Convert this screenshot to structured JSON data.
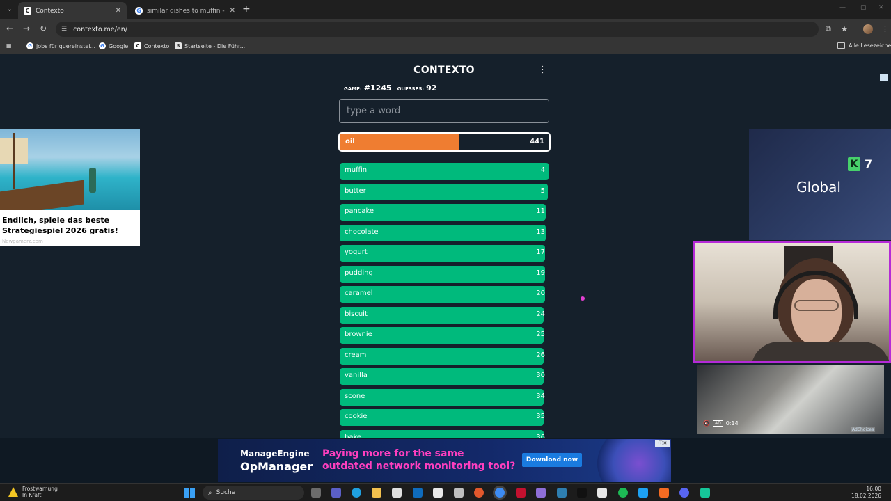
{
  "browser": {
    "tabs": [
      {
        "label": "Contexto",
        "favicon": "C",
        "active": true
      },
      {
        "label": "similar dishes to muffin - Goog",
        "favicon": "G",
        "active": false
      }
    ],
    "new_tab_icon": "+",
    "url": "contexto.me/en/",
    "bookmarks": [
      {
        "label": "jobs für quereinstei...",
        "favicon": "G"
      },
      {
        "label": "Google",
        "favicon": "G"
      },
      {
        "label": "Contexto",
        "favicon": "C"
      },
      {
        "label": "Startseite - Die Führ...",
        "favicon": "S"
      }
    ],
    "all_bookmarks_label": "Alle Lesezeichen"
  },
  "game": {
    "title": "CONTEXTO",
    "game_label": "GAME:",
    "game_number": "#1245",
    "guesses_label": "GUESSES:",
    "guesses_count": "92",
    "input_placeholder": "type a word",
    "current_guess": {
      "word": "oil",
      "rank": "441",
      "fill": 0.57
    },
    "guesses": [
      {
        "word": "muffin",
        "rank": "4",
        "fill": 1.0
      },
      {
        "word": "butter",
        "rank": "5",
        "fill": 0.995
      },
      {
        "word": "pancake",
        "rank": "11",
        "fill": 0.985
      },
      {
        "word": "chocolate",
        "rank": "13",
        "fill": 0.985
      },
      {
        "word": "yogurt",
        "rank": "17",
        "fill": 0.98
      },
      {
        "word": "pudding",
        "rank": "19",
        "fill": 0.98
      },
      {
        "word": "caramel",
        "rank": "20",
        "fill": 0.98
      },
      {
        "word": "biscuit",
        "rank": "24",
        "fill": 0.975
      },
      {
        "word": "brownie",
        "rank": "25",
        "fill": 0.975
      },
      {
        "word": "cream",
        "rank": "26",
        "fill": 0.975
      },
      {
        "word": "vanilla",
        "rank": "30",
        "fill": 0.975
      },
      {
        "word": "scone",
        "rank": "34",
        "fill": 0.975
      },
      {
        "word": "cookie",
        "rank": "35",
        "fill": 0.975
      },
      {
        "word": "bake",
        "rank": "36",
        "fill": 0.975
      }
    ],
    "colors": {
      "close": "#00ba7c",
      "medium": "#ef7d31",
      "background": "#15202b"
    }
  },
  "ads": {
    "left_caption": "Endlich, spiele das beste Strategiespiel 2026 gratis!",
    "left_domain": "Newgamerz.com",
    "right_text": "Global",
    "right_badge": "K",
    "right_number": "7",
    "video_time": "0:14",
    "video_badge": "AD",
    "adchoices": "AdChoices",
    "banner_brand_top": "ManageEngine",
    "banner_brand": "OpManager",
    "banner_message": "Paying more for the same outdated network monitoring tool?",
    "banner_button": "Download now"
  },
  "taskbar": {
    "weather_title": "Frostwarnung",
    "weather_sub": "In Kraft",
    "search_label": "Suche",
    "time": "16:00",
    "date": "18.02.2026"
  }
}
